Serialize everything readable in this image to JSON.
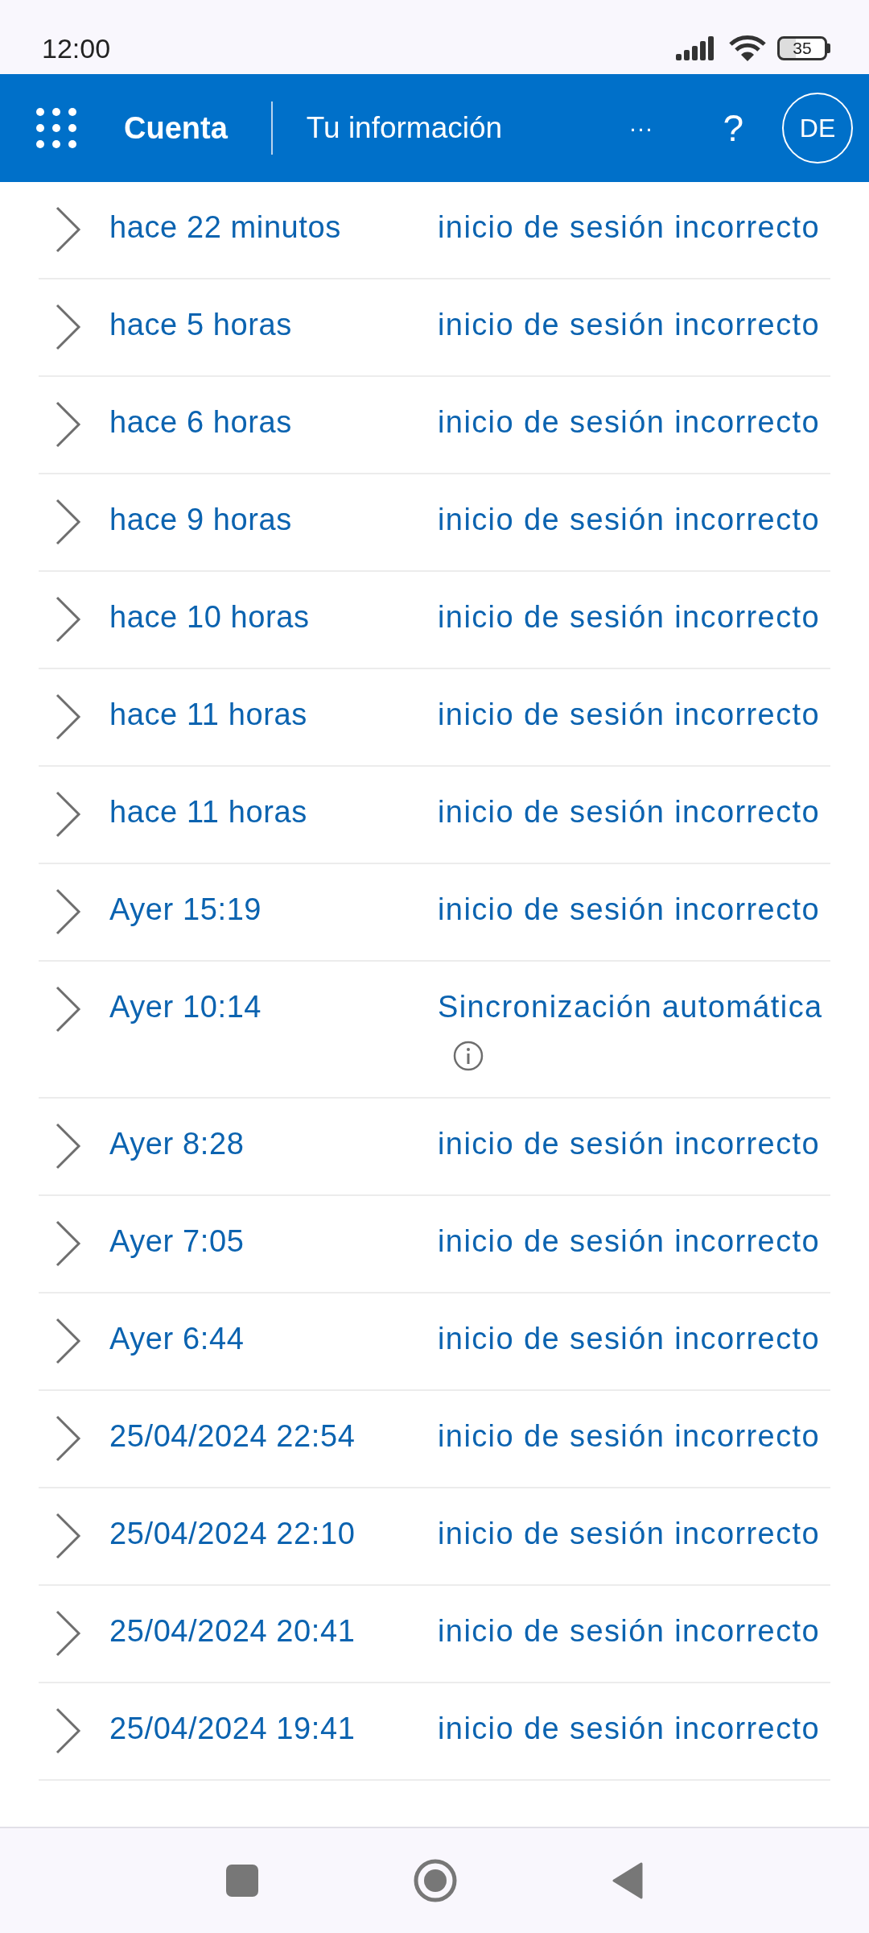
{
  "status_bar": {
    "time": "12:00",
    "battery": "35"
  },
  "header": {
    "title": "Cuenta",
    "section": "Tu información",
    "more": "···",
    "help": "?",
    "avatar": "DE"
  },
  "activity": [
    {
      "when": "hace 22 minutos",
      "event": "inicio de sesión incorrecto",
      "info_icon": false
    },
    {
      "when": "hace 5 horas",
      "event": "inicio de sesión incorrecto",
      "info_icon": false
    },
    {
      "when": "hace 6 horas",
      "event": "inicio de sesión incorrecto",
      "info_icon": false
    },
    {
      "when": "hace 9 horas",
      "event": "inicio de sesión incorrecto",
      "info_icon": false
    },
    {
      "when": "hace 10 horas",
      "event": "inicio de sesión incorrecto",
      "info_icon": false
    },
    {
      "when": "hace 11 horas",
      "event": "inicio de sesión incorrecto",
      "info_icon": false
    },
    {
      "when": "hace 11 horas",
      "event": "inicio de sesión incorrecto",
      "info_icon": false
    },
    {
      "when": "Ayer 15:19",
      "event": "inicio de sesión incorrecto",
      "info_icon": false
    },
    {
      "when": "Ayer 10:14",
      "event": "Sincronización automática",
      "info_icon": true
    },
    {
      "when": "Ayer 8:28",
      "event": "inicio de sesión incorrecto",
      "info_icon": false
    },
    {
      "when": "Ayer 7:05",
      "event": "inicio de sesión incorrecto",
      "info_icon": false
    },
    {
      "when": "Ayer 6:44",
      "event": "inicio de sesión incorrecto",
      "info_icon": false
    },
    {
      "when": "25/04/2024 22:54",
      "event": "inicio de sesión incorrecto",
      "info_icon": false
    },
    {
      "when": "25/04/2024 22:10",
      "event": "inicio de sesión incorrecto",
      "info_icon": false
    },
    {
      "when": "25/04/2024 20:41",
      "event": "inicio de sesión incorrecto",
      "info_icon": false
    },
    {
      "when": "25/04/2024 19:41",
      "event": "inicio de sesión incorrecto",
      "info_icon": false
    }
  ]
}
